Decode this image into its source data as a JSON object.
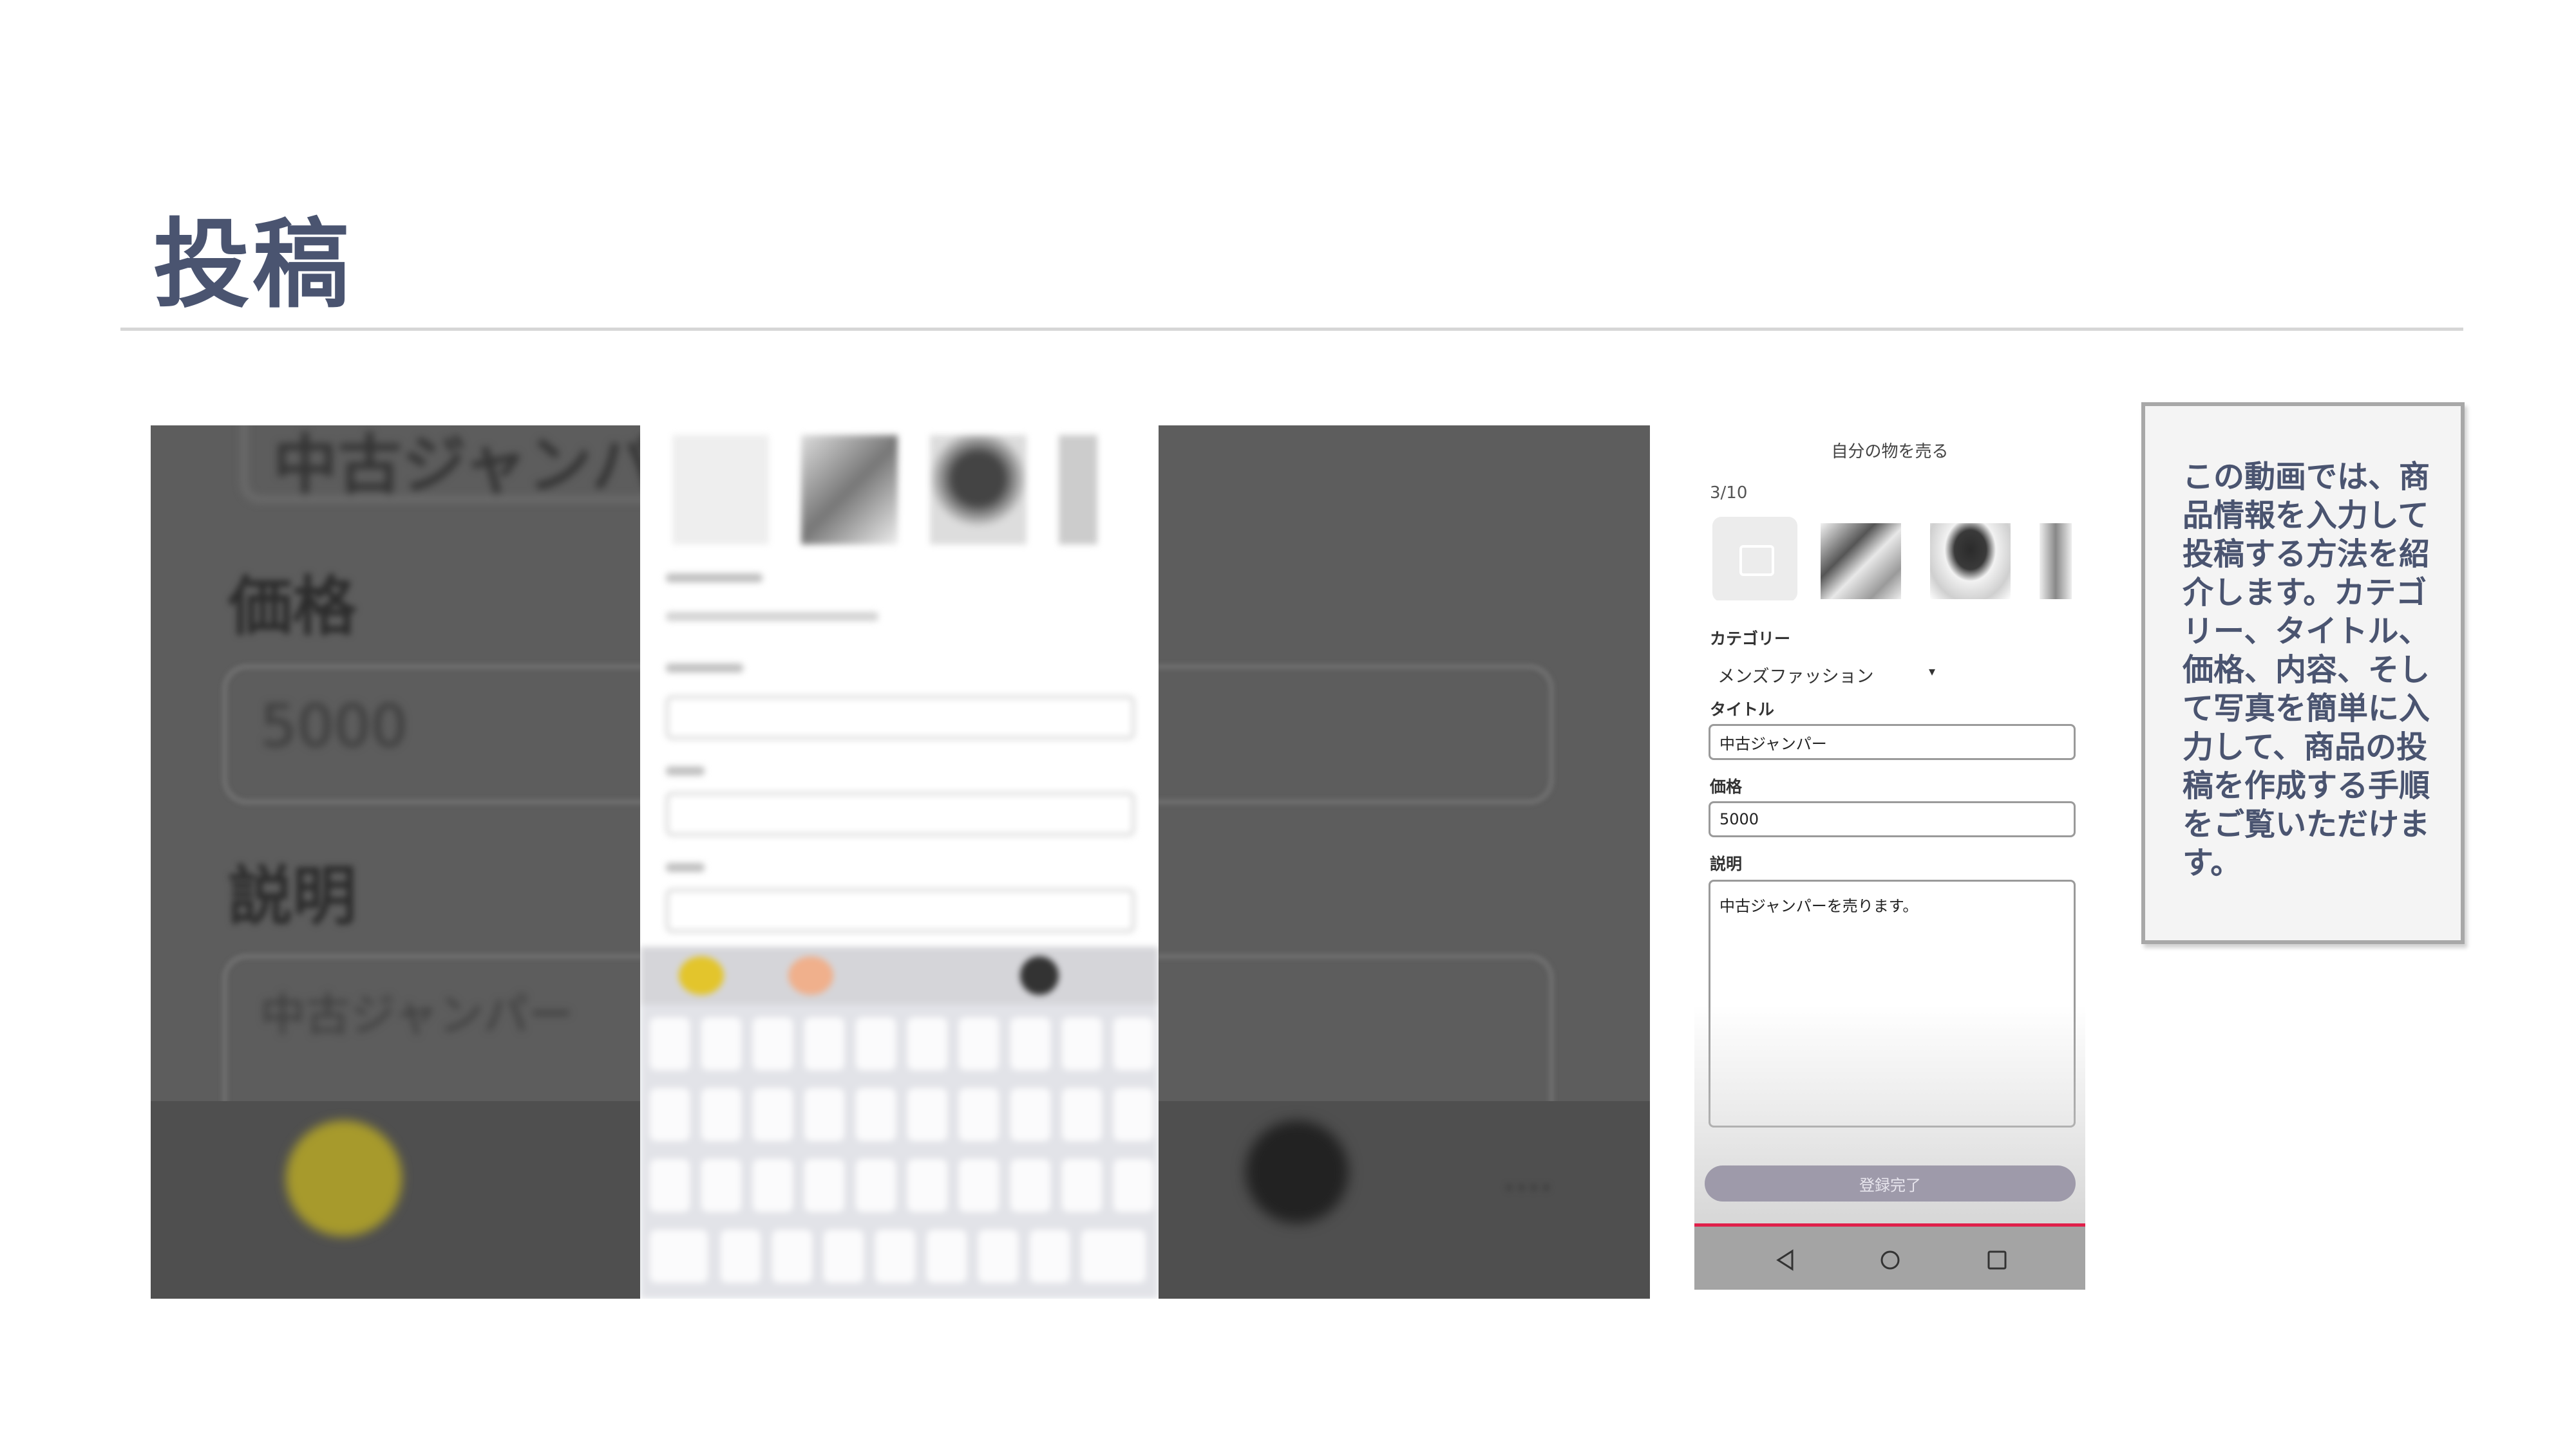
{
  "slide": {
    "title": "投稿",
    "description": "この動画では、商品情報を入力して投稿する方法を紹介します。カテゴリー、タイトル、価格、内容、そして写真を簡単に入力して、商品の投稿を作成する手順をご覧いただけます。"
  },
  "video_frame": {
    "bg_title": "中古ジャンパ",
    "label_price": "価格",
    "price_value": "5000",
    "label_description": "説明",
    "desc_value": "中古ジャンパー"
  },
  "phone": {
    "header": "自分の物を売る",
    "photo_count": "3/10",
    "category_label": "カテゴリー",
    "category_value": "メンズファッション",
    "title_label": "タイトル",
    "title_value": "中古ジャンパー",
    "price_label": "価格",
    "price_value": "5000",
    "description_label": "説明",
    "description_value": "中古ジャンパーを売ります。",
    "submit_label": "登録完了",
    "nav_icons": [
      "back-icon",
      "home-icon",
      "recents-icon"
    ]
  },
  "colors": {
    "title": "#4a5470",
    "submit": "#9e9aaa",
    "accent_line": "#e0204a"
  }
}
